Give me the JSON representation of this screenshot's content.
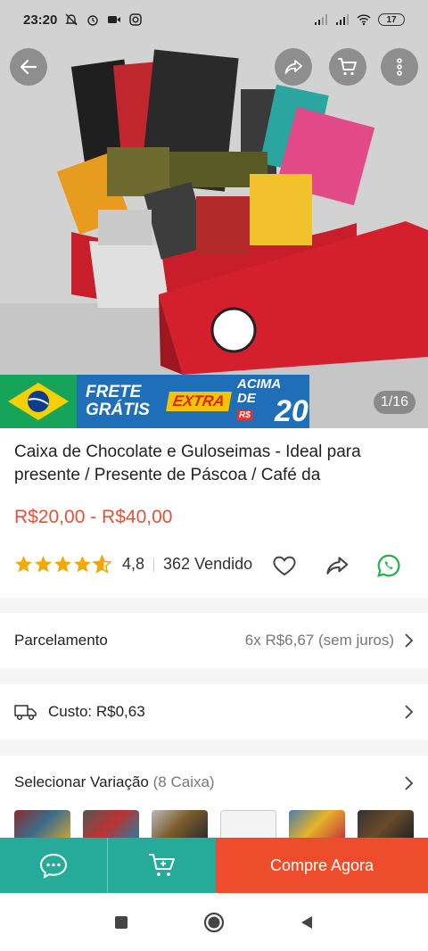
{
  "status_bar": {
    "time": "23:20",
    "battery": "17"
  },
  "hero": {
    "image_counter": "1/16",
    "banner": {
      "line1": "FRETE",
      "line2": "GRÁTIS",
      "extra": "EXTRA",
      "acima": "ACIMA",
      "de": "DE",
      "currency": "R$",
      "amount": "20"
    }
  },
  "product": {
    "title": "Caixa de Chocolate e Guloseimas - Ideal para presente / Presente de Páscoa / Café da",
    "price_range": "R$20,00 - R$40,00",
    "rating": "4,8",
    "sold": "362 Vendido",
    "stars_filled": 4.5
  },
  "parcelamento": {
    "label": "Parcelamento",
    "value": "6x R$6,67 (sem juros)"
  },
  "shipping": {
    "label": "Custo: R$0,63"
  },
  "variation": {
    "label": "Selecionar Variação",
    "count": "(8 Caixa)"
  },
  "actions": {
    "buy_now": "Compre Agora"
  },
  "colors": {
    "brand_orange": "#ee4d2d",
    "teal": "#26aa99",
    "price": "#e0533a"
  }
}
